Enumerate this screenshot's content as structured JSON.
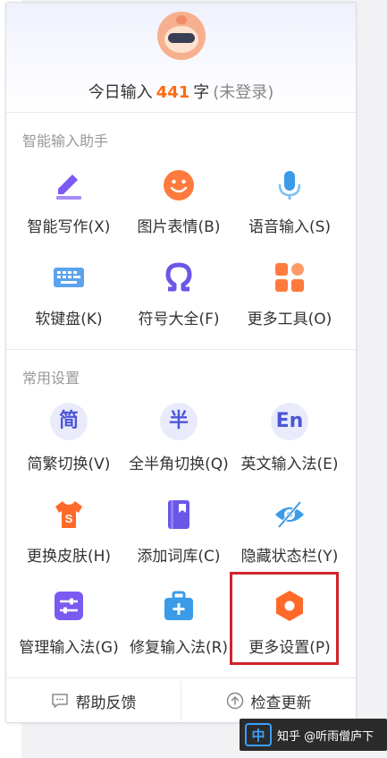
{
  "header": {
    "prefix": "今日输入",
    "count": "441",
    "unit": "字",
    "login_status": "(未登录)"
  },
  "sections": {
    "assistant_title": "智能输入助手",
    "settings_title": "常用设置"
  },
  "assistant_items": [
    {
      "label": "智能写作(X)",
      "icon": "pen-icon"
    },
    {
      "label": "图片表情(B)",
      "icon": "smiley-icon"
    },
    {
      "label": "语音输入(S)",
      "icon": "microphone-icon"
    },
    {
      "label": "软键盘(K)",
      "icon": "keyboard-icon"
    },
    {
      "label": "符号大全(F)",
      "icon": "omega-icon"
    },
    {
      "label": "更多工具(O)",
      "icon": "grid-icon"
    }
  ],
  "settings_items": [
    {
      "label": "简繁切换(V)",
      "icon_text": "简"
    },
    {
      "label": "全半角切换(Q)",
      "icon_text": "半"
    },
    {
      "label": "英文输入法(E)",
      "icon_text": "En"
    },
    {
      "label": "更换皮肤(H)",
      "icon": "shirt-icon"
    },
    {
      "label": "添加词库(C)",
      "icon": "book-icon"
    },
    {
      "label": "隐藏状态栏(Y)",
      "icon": "eye-hidden-icon"
    },
    {
      "label": "管理输入法(G)",
      "icon": "sliders-icon"
    },
    {
      "label": "修复输入法(R)",
      "icon": "toolbox-icon"
    },
    {
      "label": "更多设置(P)",
      "icon": "hexagon-gear-icon"
    }
  ],
  "footer": {
    "help": "帮助反馈",
    "update": "检查更新"
  },
  "watermark": {
    "text": "知乎 @听雨僧庐下"
  },
  "colors": {
    "accent_orange": "#ff6a12",
    "accent_blue": "#4c56d6",
    "highlight_red": "#d2232a"
  }
}
